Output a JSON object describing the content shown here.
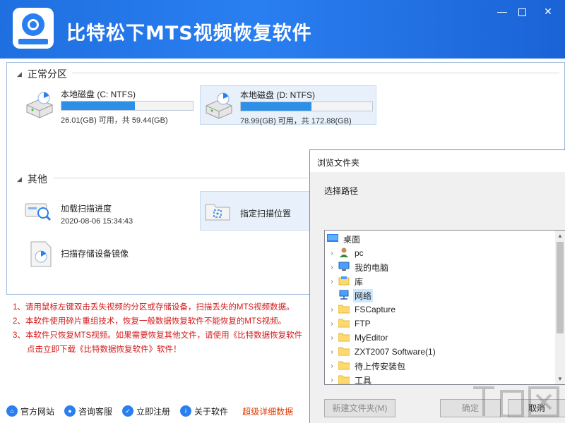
{
  "app": {
    "title": "比特松下MTS视频恢复软件",
    "window_controls": {
      "minimize": "—",
      "close": "✕"
    }
  },
  "sections": {
    "partitions_label": "正常分区",
    "other_label": "其他"
  },
  "disks": [
    {
      "name": "本地磁盘 (C: NTFS)",
      "info": "26.01(GB) 可用，共 59.44(GB)",
      "used_fraction": 0.56
    },
    {
      "name": "本地磁盘 (D: NTFS)",
      "info": "78.99(GB) 可用，共 172.88(GB)",
      "used_fraction": 0.54
    }
  ],
  "other_items": {
    "load_progress": {
      "label": "加载扫描进度",
      "time": "2020-08-06 15:34:43"
    },
    "scan_location": {
      "label": "指定扫描位置"
    },
    "scan_image": {
      "label": "扫描存储设备镜像"
    }
  },
  "notes": [
    "1、请用鼠标左键双击丢失视频的分区或存储设备，扫描丢失的MTS视频数据。",
    "2、本软件使用碎片重组技术，恢复一般数据恢复软件不能恢复的MTS视频。",
    "3、本软件只恢复MTS视频。如果需要恢复其他文件，请使用《比特数据恢复软件",
    "点击立即下载《比特数据恢复软件》软件！"
  ],
  "bottom_bar": {
    "website": "官方网站",
    "support": "咨询客服",
    "register": "立即注册",
    "about": "关于软件",
    "link": "超级详细数据"
  },
  "dialog": {
    "title": "浏览文件夹",
    "label": "选择路径",
    "tree": [
      {
        "label": "桌面",
        "icon": "desktop-icon",
        "level": 0,
        "expandable": false
      },
      {
        "label": "pc",
        "icon": "user-icon",
        "level": 1,
        "expandable": true
      },
      {
        "label": "我的电脑",
        "icon": "computer-icon",
        "level": 1,
        "expandable": true
      },
      {
        "label": "库",
        "icon": "library-icon",
        "level": 1,
        "expandable": true
      },
      {
        "label": "网络",
        "icon": "network-icon",
        "level": 1,
        "expandable": false,
        "selected": true
      },
      {
        "label": "FSCapture",
        "icon": "folder-icon",
        "level": 1,
        "expandable": true
      },
      {
        "label": "FTP",
        "icon": "folder-icon",
        "level": 1,
        "expandable": true
      },
      {
        "label": "MyEditor",
        "icon": "folder-icon",
        "level": 1,
        "expandable": true
      },
      {
        "label": "ZXT2007 Software(1)",
        "icon": "folder-icon",
        "level": 1,
        "expandable": true
      },
      {
        "label": "待上传安装包",
        "icon": "folder-icon",
        "level": 1,
        "expandable": true
      },
      {
        "label": "工具",
        "icon": "folder-icon",
        "level": 1,
        "expandable": true
      }
    ],
    "buttons": {
      "new_folder": "新建文件夹(M)",
      "ok": "确定",
      "cancel": "取消"
    }
  },
  "colors": {
    "title_bar": "#2a7ff0",
    "progress": "#2e8fe6",
    "note_text": "#d21a1a",
    "selected_card": "#e8f1fb"
  }
}
